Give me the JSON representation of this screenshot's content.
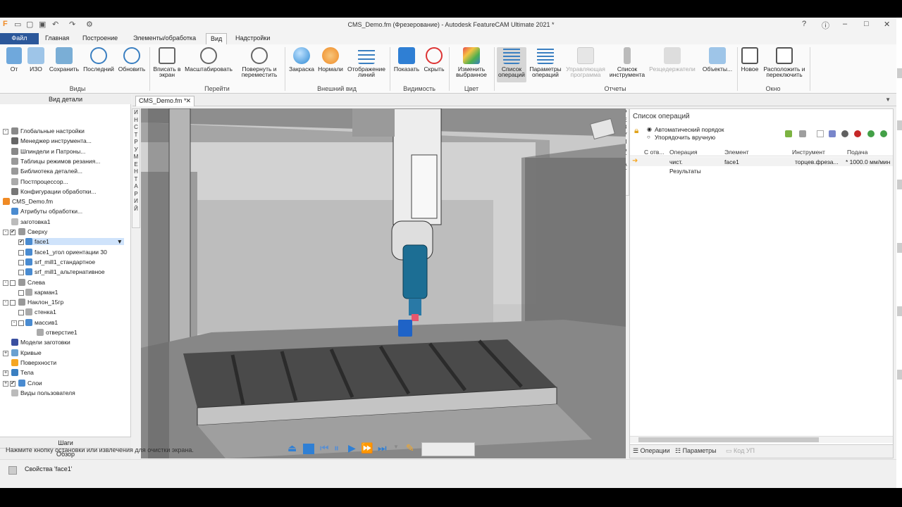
{
  "window": {
    "title": "CMS_Demo.fm (Фрезерование) - Autodesk FeatureCAM Ultimate 2021 *"
  },
  "ribbon_tabs": [
    "Файл",
    "Главная",
    "Построение",
    "Элементы/обработка",
    "Вид",
    "Надстройки"
  ],
  "ribbon": {
    "views": {
      "group": "Виды",
      "buttons": [
        "От",
        "ИЗО",
        "Сохранить",
        "Последний",
        "Обновить"
      ]
    },
    "goto": {
      "group": "Перейти",
      "buttons": [
        "Вписать в экран",
        "Масштабировать",
        "Повернуть и переместить"
      ]
    },
    "appearance": {
      "group": "Внешний вид",
      "buttons": [
        "Закраска",
        "Нормали",
        "Отображение линий"
      ]
    },
    "visibility": {
      "group": "Видимость",
      "buttons": [
        "Показать",
        "Скрыть"
      ]
    },
    "color": {
      "group": "Цвет",
      "buttons": [
        "Изменить выбранное"
      ]
    },
    "reports": {
      "group": "Отчеты",
      "buttons": [
        "Список операций",
        "Параметры операций",
        "Управляющая программа",
        "Список инструмента",
        "Резцедержатели",
        "Объекты..."
      ]
    },
    "window": {
      "group": "Окно",
      "buttons": [
        "Новое",
        "Расположить и переключить"
      ]
    }
  },
  "left_panel": {
    "title": "Вид детали",
    "tree": [
      "Глобальные настройки",
      "Менеджер инструмента...",
      "Шпиндели и Патроны...",
      "Таблицы режимов резания...",
      "Библиотека деталей...",
      "Постпроцессор...",
      "Конфигурации обработки...",
      "CMS_Demo.fm",
      "Атрибуты обработки...",
      "заготовка1",
      "Сверху",
      "face1",
      "face1_угол ориентации 30",
      "srf_mill1_стандартное",
      "srf_mill1_альтернативное",
      "Слева",
      "карман1",
      "Наклон_15гр",
      "стенка1",
      "массив1",
      "отверстие1",
      "Модели заготовки",
      "Кривые",
      "Поверхности",
      "Тела",
      "Слои",
      "Виды пользователя"
    ],
    "footer": [
      "Шаги",
      "Обзор"
    ]
  },
  "doc_tab": "CMS_Demo.fm *",
  "left_strip": "ИНСТРУМЕНТАРИЙ",
  "right_strip": "РЕЗУЛЬТАТ",
  "operations": {
    "title": "Список операций",
    "order_auto": "Автоматический порядок",
    "order_manual": "Упорядочить вручную",
    "columns": [
      "С отв...",
      "Операция",
      "Элемент",
      "Инструмент",
      "Подача"
    ],
    "row": {
      "operation": "чист.",
      "element": "face1",
      "tool": "торцев.фреза...",
      "feed": "* 1000.0 мм/мин"
    },
    "results": "Результаты",
    "tabs": [
      "Операции",
      "Параметры",
      "Код УП"
    ]
  },
  "status_line": "Нажмите кнопку остановки или извлечения для очистки экрана.",
  "properties": "Свойства 'face1'",
  "colors": {
    "file_tab": "#2b579a",
    "accent": "#f5a623",
    "tool_head": "#1c6e94"
  }
}
